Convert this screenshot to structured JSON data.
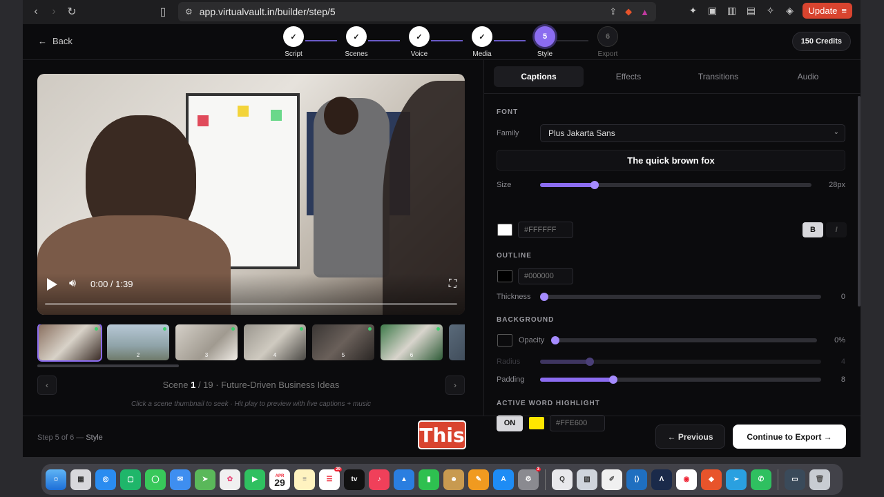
{
  "browser": {
    "url": "app.virtualvault.in/builder/step/5",
    "update_label": "Update"
  },
  "topbar": {
    "back_label": "Back",
    "credits": "150 Credits"
  },
  "steps": [
    {
      "num": "✓",
      "label": "Script",
      "state": "done"
    },
    {
      "num": "✓",
      "label": "Scenes",
      "state": "done"
    },
    {
      "num": "✓",
      "label": "Voice",
      "state": "done"
    },
    {
      "num": "✓",
      "label": "Media",
      "state": "done"
    },
    {
      "num": "5",
      "label": "Style",
      "state": "active"
    },
    {
      "num": "6",
      "label": "Export",
      "state": "todo"
    }
  ],
  "player": {
    "time": "0:00 / 1:39",
    "progress": 0
  },
  "thumbnails": [
    "",
    "2",
    "3",
    "4",
    "5",
    "6",
    ""
  ],
  "scene_nav": {
    "prefix": "Scene",
    "current": "1",
    "rest": "/ 19 · Future-Driven Business Ideas",
    "hint": "Click a scene thumbnail to seek · Hit play to preview with live captions + music"
  },
  "tabs": [
    "Captions",
    "Effects",
    "Transitions",
    "Audio"
  ],
  "captions": {
    "font_section": "FONT",
    "family_label": "Family",
    "family_value": "Plus Jakarta Sans",
    "preview_text": "The quick brown fox",
    "size_label": "Size",
    "size_value": "28px",
    "size_level": 0.2,
    "text_color": "#FFFFFF",
    "bold_label": "B",
    "italic_label": "I",
    "outline_section": "OUTLINE",
    "outline_color": "#000000",
    "thickness_label": "Thickness",
    "thickness_value": "0",
    "background_section": "BACKGROUND",
    "opacity_label": "Opacity",
    "opacity_value": "0%",
    "radius_label": "Radius",
    "radius_value": "4",
    "padding_label": "Padding",
    "padding_value": "8",
    "highlight_section": "ACTIVE WORD HIGHLIGHT",
    "highlight_toggle": "ON",
    "highlight_color": "#FFE600"
  },
  "footer": {
    "step_info_prefix": "Step 5 of 6 —",
    "step_info_name": "Style",
    "prev_label": "← Previous",
    "continue_label": "Continue to Export →"
  },
  "caption_overlay": "This",
  "dock": {
    "calendar_month": "APR",
    "calendar_day": "29",
    "reminders_badge": "29",
    "settings_badge": "3",
    "tv_label": "tv"
  },
  "colors": {
    "accent": "#8b6cf0",
    "update": "#d9442f",
    "highlight": "#FFE600"
  }
}
